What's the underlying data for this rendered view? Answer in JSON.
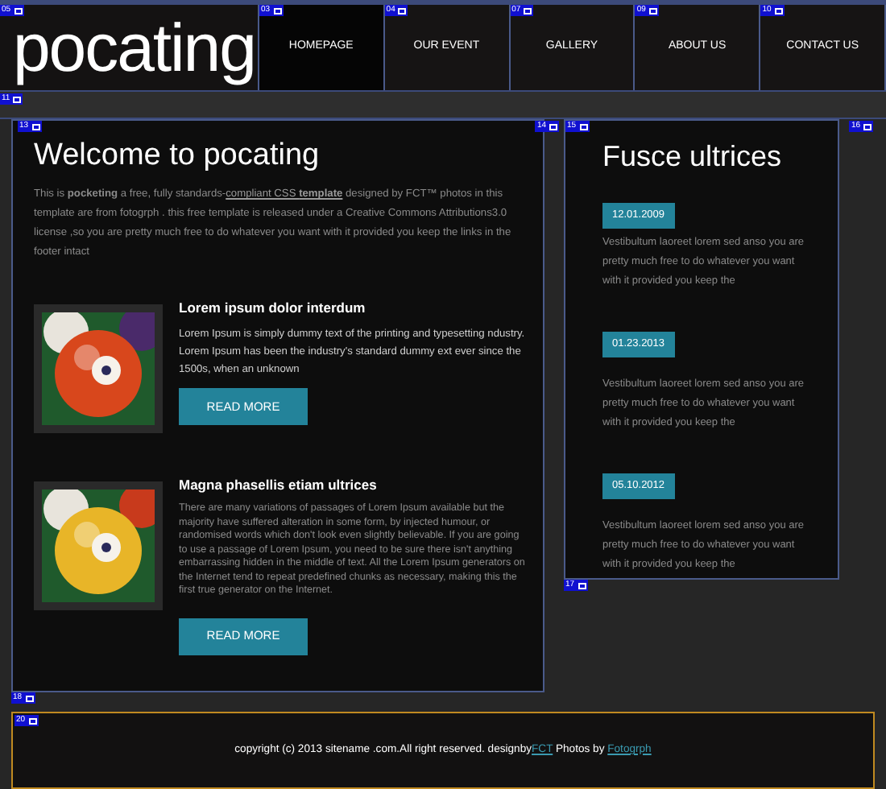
{
  "logo": {
    "text": "pocating",
    "marker": "05"
  },
  "nav": [
    {
      "label": "HOMEPAGE",
      "selected": true,
      "marker": "03"
    },
    {
      "label": "OUR EVENT",
      "selected": false,
      "marker": "04"
    },
    {
      "label": "GALLERY",
      "selected": false,
      "marker": "07"
    },
    {
      "label": "ABOUT US",
      "selected": false,
      "marker": "09"
    },
    {
      "label": "CONTACT US",
      "selected": false,
      "marker": "10"
    }
  ],
  "band": {
    "marker": "11"
  },
  "main": {
    "marker": "13",
    "side_marker": "14",
    "bottom_marker": "18",
    "title": "Welcome to pocating",
    "intro_before": "This is **pocketing** a free, fully standards-",
    "intro_link": "compliant CSS **template**",
    "intro_after": " designed by FCT™ photos in this template are from  fotogrph . this free template is released under a Creative Commons Attributions3.0 license ,so you are pretty much free to do whatever you want with it provided you keep the links in the footer intact",
    "articles": [
      {
        "title": "Lorem ipsum dolor interdum",
        "body": "Lorem Ipsum is simply dummy text of the printing and typesetting ndustry. Lorem Ipsum has been the industry's standard dummy ext ever since the 1500s, when an unknown",
        "button": "READ MORE"
      },
      {
        "title": "Magna phasellis etiam ultrices",
        "body": "There are many variations of passages of Lorem Ipsum available but the majority have suffered alteration in some form, by injected humour, or randomised words which don't look even slightly believable. If you are going to use a passage of Lorem Ipsum, you need to be sure there isn't anything embarrassing hidden in the middle of text. All the Lorem Ipsum generators on the Internet tend to repeat predefined chunks as necessary, making this the first true generator on the Internet.",
        "button": "READ MORE"
      }
    ]
  },
  "sidebar": {
    "marker": "15",
    "side_marker": "16",
    "bottom_marker": "17",
    "title": "Fusce ultrices",
    "news": [
      {
        "date": "12.01.2009",
        "text": "Vestibultum laoreet lorem sed anso you are pretty much free to do whatever you want with it provided you keep the"
      },
      {
        "date": "01.23.2013",
        "text": "Vestibultum laoreet lorem sed anso you are pretty much free to do whatever you want with it provided you keep the"
      },
      {
        "date": "05.10.2012",
        "text": "Vestibultum laoreet lorem sed anso you are pretty much free to do whatever you want with it provided you keep the"
      }
    ]
  },
  "footer": {
    "marker": "20",
    "text": "copyright (c) 2013 sitename .com.All right reserved.  designby",
    "link1": "FCT",
    "middle": " Photos by ",
    "link2": "Fotogrph"
  }
}
